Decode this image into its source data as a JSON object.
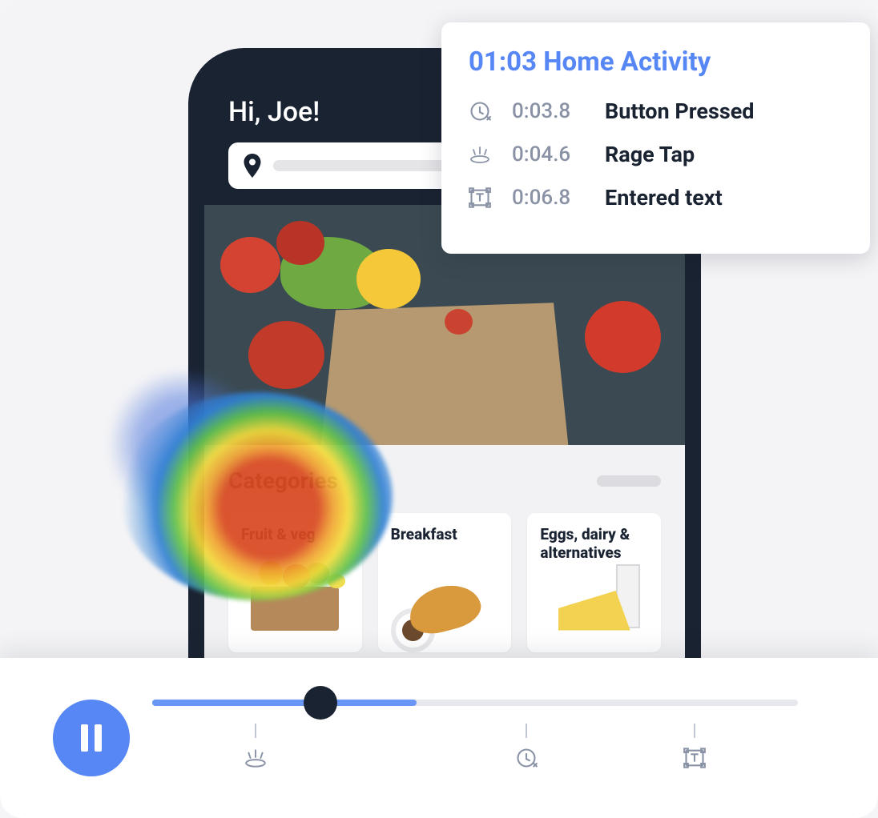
{
  "app": {
    "greeting": "Hi, Joe!",
    "section_title": "Categories",
    "categories": [
      {
        "label": "Fruit & veg"
      },
      {
        "label": "Breakfast"
      },
      {
        "label": "Eggs, dairy & alternatives"
      }
    ]
  },
  "event_card": {
    "title": "01:03 Home Activity",
    "events": [
      {
        "icon": "tap-icon",
        "time": "0:03.8",
        "label": "Button Pressed"
      },
      {
        "icon": "rage-tap-icon",
        "time": "0:04.6",
        "label": "Rage Tap"
      },
      {
        "icon": "text-box-icon",
        "time": "0:06.8",
        "label": "Entered text"
      }
    ]
  },
  "player": {
    "progress_percent": 41,
    "thumb_percent": 26,
    "markers": [
      {
        "icon": "rage-tap-icon",
        "position_percent": 16
      },
      {
        "icon": "tap-icon",
        "position_percent": 58
      },
      {
        "icon": "text-box-icon",
        "position_percent": 84
      }
    ]
  },
  "colors": {
    "accent": "#5687f5",
    "dark": "#1a2332",
    "muted": "#8a93a6"
  }
}
